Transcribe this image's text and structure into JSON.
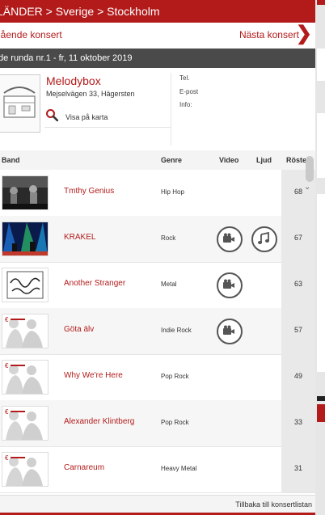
{
  "breadcrumb": "LÄNDER > Sverige > Stockholm",
  "nav": {
    "prev_label": "gående konsert",
    "next_label": "Nästa konsert",
    "next_chevron": "❯"
  },
  "round_title": "de runda nr.1 - fr, 11 oktober 2019",
  "venue": {
    "logo_text": "...",
    "name": "Melodybox",
    "address": "Mejselvägen 33, Hägersten",
    "map_link": "Visa på karta",
    "contact": {
      "tel": "Tel.",
      "email": "E-post",
      "info": "Info:"
    }
  },
  "table": {
    "headers": {
      "band": "Band",
      "genre": "Genre",
      "video": "Video",
      "audio": "Ljud",
      "votes": "Röster"
    },
    "rows": [
      {
        "band": "Tmthy Genius",
        "genre": "Hip Hop",
        "video": false,
        "audio": false,
        "votes": "68",
        "thumb": "bw-stage"
      },
      {
        "band": "KRAKEL",
        "genre": "Rock",
        "video": true,
        "audio": true,
        "votes": "67",
        "thumb": "concert-lights"
      },
      {
        "band": "Another Stranger",
        "genre": "Metal",
        "video": true,
        "audio": false,
        "votes": "63",
        "thumb": "logo-script"
      },
      {
        "band": "Göta älv",
        "genre": "Indie Rock",
        "video": true,
        "audio": false,
        "votes": "57",
        "thumb": "placeholder"
      },
      {
        "band": "Why We're Here",
        "genre": "Pop Rock",
        "video": false,
        "audio": false,
        "votes": "49",
        "thumb": "placeholder"
      },
      {
        "band": "Alexander Klintberg",
        "genre": "Pop Rock",
        "video": false,
        "audio": false,
        "votes": "33",
        "thumb": "placeholder"
      },
      {
        "band": "Carnareum",
        "genre": "Heavy Metal",
        "video": false,
        "audio": false,
        "votes": "31",
        "thumb": "placeholder"
      }
    ]
  },
  "footer_link": "Tillbaka till konsertlistan",
  "colors": {
    "brand": "#b31b1b",
    "dark_bar": "#4a4a4a",
    "icon": "#555555"
  }
}
